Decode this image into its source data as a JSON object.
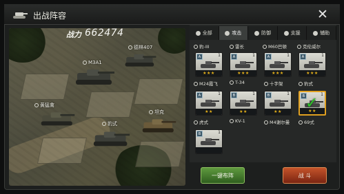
{
  "window": {
    "title": "出战阵容",
    "close_label": "✕"
  },
  "field": {
    "power_label": "战力",
    "power_value": "662474",
    "slots": [
      {
        "label": "M3A1"
      },
      {
        "label": "德林407"
      },
      {
        "label": "黄猛禽"
      },
      {
        "label": "豹式"
      },
      {
        "label": "坦克"
      }
    ]
  },
  "tabs": [
    {
      "label": "全部",
      "icon": "all-icon"
    },
    {
      "label": "攻击",
      "icon": "attack-icon"
    },
    {
      "label": "防御",
      "icon": "defense-icon"
    },
    {
      "label": "支援",
      "icon": "support-icon"
    },
    {
      "label": "辅助",
      "icon": "assist-icon"
    }
  ],
  "row_top_labels": [
    "豹-III",
    "雷长",
    "M60巴顿",
    "克伦威尔"
  ],
  "cards": [
    {
      "tier": "A",
      "num": "1",
      "stars": "★★★",
      "label": "M24霞飞"
    },
    {
      "tier": "A",
      "num": "1",
      "stars": "★★★",
      "label": "T-34"
    },
    {
      "tier": "A",
      "num": "1",
      "stars": "★★★",
      "label": "十字架"
    },
    {
      "tier": "A",
      "num": "1",
      "stars": "★★★",
      "label": "豹式"
    },
    {
      "tier": "A",
      "num": "1",
      "stars": "★★",
      "label": "虎式"
    },
    {
      "tier": "B",
      "num": "1",
      "stars": "★★",
      "label": "KV-1"
    },
    {
      "tier": "B",
      "num": "1",
      "stars": "★★",
      "label": "M4谢尔曼"
    },
    {
      "tier": "B",
      "num": "1",
      "stars": "★★",
      "label": "69式"
    },
    {
      "tier": "B",
      "num": "1",
      "stars": "",
      "label": ""
    }
  ],
  "buttons": {
    "deploy": "一键布阵",
    "battle": "战 斗"
  },
  "colors": {
    "accent_green": "#2fc52a",
    "star": "#e7b21a",
    "deploy_button": "#4a7f33",
    "battle_button": "#a53e1e"
  }
}
